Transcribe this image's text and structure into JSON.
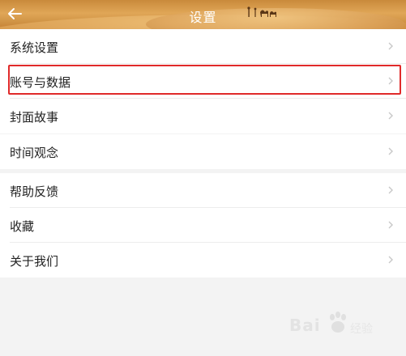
{
  "header": {
    "title": "设置",
    "back_icon": "arrow-left-icon"
  },
  "groups": [
    {
      "items": [
        {
          "label": "系统设置"
        },
        {
          "label": "账号与数据"
        },
        {
          "label": "封面故事"
        }
      ]
    },
    {
      "items": [
        {
          "label": "时间观念"
        }
      ]
    },
    {
      "items": [
        {
          "label": "帮助反馈"
        },
        {
          "label": "收藏"
        },
        {
          "label": "关于我们"
        }
      ]
    }
  ],
  "highlighted_item": "账号与数据",
  "watermark": {
    "brand": "Bai",
    "suffix": "经验",
    "icon": "baidu-paw-icon"
  },
  "colors": {
    "highlight": "#e02a2a",
    "background": "#f3f3f3"
  }
}
